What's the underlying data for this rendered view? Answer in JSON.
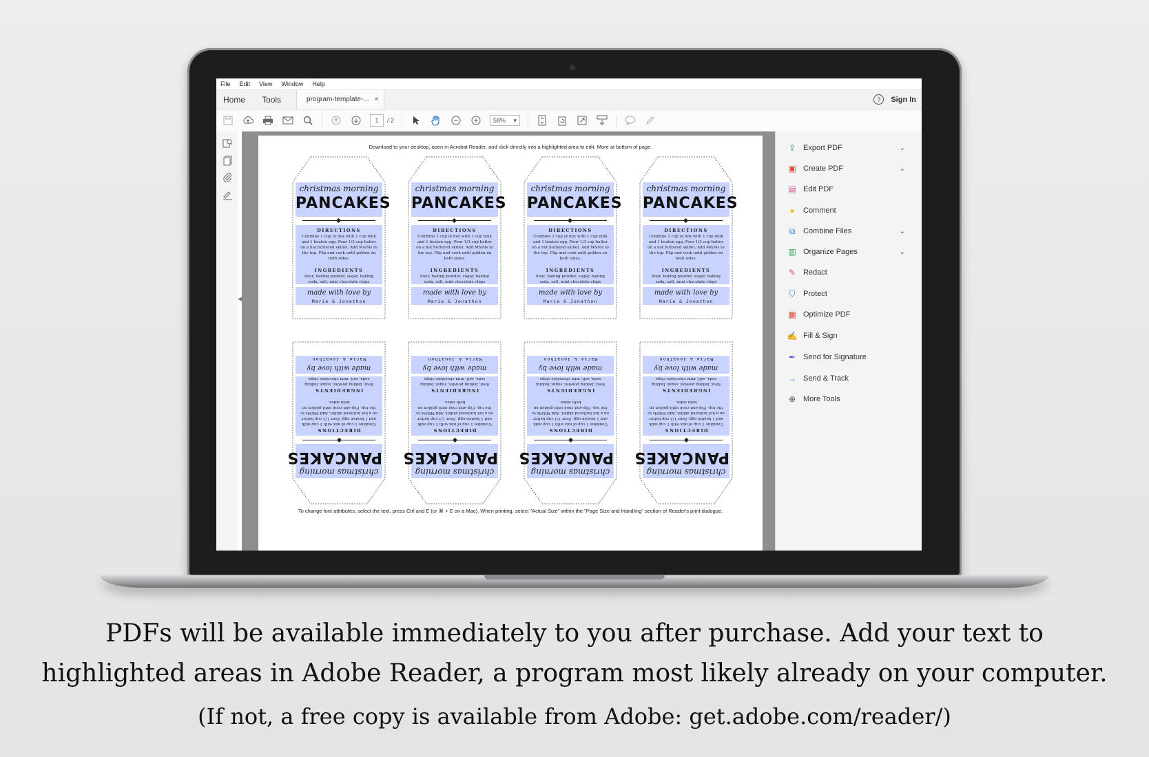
{
  "app": {
    "menu": [
      "File",
      "Edit",
      "View",
      "Window",
      "Help"
    ],
    "nav": [
      "Home",
      "Tools"
    ],
    "doc_tab": "program-template-...",
    "doc_tab_close": "×",
    "help_glyph": "?",
    "sign_in": "Sign In"
  },
  "toolbar": {
    "page_current": "1",
    "page_total": "/ 2",
    "zoom": "58%",
    "zoom_arrow": "▾"
  },
  "pdf": {
    "top_note": "Download to your desktop, open in Acrobat Reader, and click directly into a highlighted area to edit. More at bottom of page.",
    "bottom_note": "To change font attributes, select the text, press Ctrl and E (or ⌘ + E on a Mac).  When printing, select \"Actual Size\" within the \"Page Size and Handling\" section of Reader's print dialogue.",
    "tag": {
      "script_title": "christmas morning",
      "title": "PANCAKES",
      "directions_heading": "DIRECTIONS",
      "directions": "Combine 1 cup of mix with 1 cup milk and 1 beaten egg.  Pour 1/3 cup batter on a hot buttered skillet.  Add M&Ms to the top.  Flip and cook until golden on both sides.",
      "ingredients_heading": "INGREDIENTS",
      "ingredients": "flour, baking powder, sugar, baking soda, salt, mini chocolate chips",
      "signature": "made with love by",
      "names": "Marie & Jonathon"
    },
    "highlight_color": "#c9d3ff"
  },
  "right_pane": {
    "items": [
      {
        "label": "Export PDF",
        "icon": "export-pdf-icon",
        "glyph": "⇪",
        "color": "#2a9d6a",
        "chevron": true
      },
      {
        "label": "Create PDF",
        "icon": "create-pdf-icon",
        "glyph": "▣",
        "color": "#e2483d",
        "chevron": true
      },
      {
        "label": "Edit PDF",
        "icon": "edit-pdf-icon",
        "glyph": "▤",
        "color": "#e8428c",
        "chevron": false
      },
      {
        "label": "Comment",
        "icon": "comment-icon",
        "glyph": "●",
        "color": "#f2c12e",
        "chevron": false
      },
      {
        "label": "Combine Files",
        "icon": "combine-files-icon",
        "glyph": "⧉",
        "color": "#2b7bd6",
        "chevron": true
      },
      {
        "label": "Organize Pages",
        "icon": "organize-pages-icon",
        "glyph": "▥",
        "color": "#3aa86b",
        "chevron": true
      },
      {
        "label": "Redact",
        "icon": "redact-icon",
        "glyph": "✎",
        "color": "#e8428c",
        "chevron": false
      },
      {
        "label": "Protect",
        "icon": "protect-icon",
        "glyph": "⛉",
        "color": "#2b7bd6",
        "chevron": false
      },
      {
        "label": "Optimize PDF",
        "icon": "optimize-pdf-icon",
        "glyph": "▦",
        "color": "#e2483d",
        "chevron": false
      },
      {
        "label": "Fill & Sign",
        "icon": "fill-sign-icon",
        "glyph": "✍",
        "color": "#7b5cd6",
        "chevron": false
      },
      {
        "label": "Send for Signature",
        "icon": "send-for-signature-icon",
        "glyph": "✒",
        "color": "#7b5cd6",
        "chevron": false
      },
      {
        "label": "Send & Track",
        "icon": "send-track-icon",
        "glyph": "→",
        "color": "#2b7bd6",
        "chevron": false
      },
      {
        "label": "More Tools",
        "icon": "more-tools-icon",
        "glyph": "⊕",
        "color": "#555555",
        "chevron": false
      }
    ],
    "chevron_glyph": "⌄"
  },
  "caption": {
    "line1": "PDFs will be available immediately to you after purchase.  Add your text to",
    "line2": "highlighted areas in Adobe Reader, a program most likely already on your computer.",
    "line3": "(If not, a free copy is available from Adobe: get.adobe.com/reader/)"
  }
}
